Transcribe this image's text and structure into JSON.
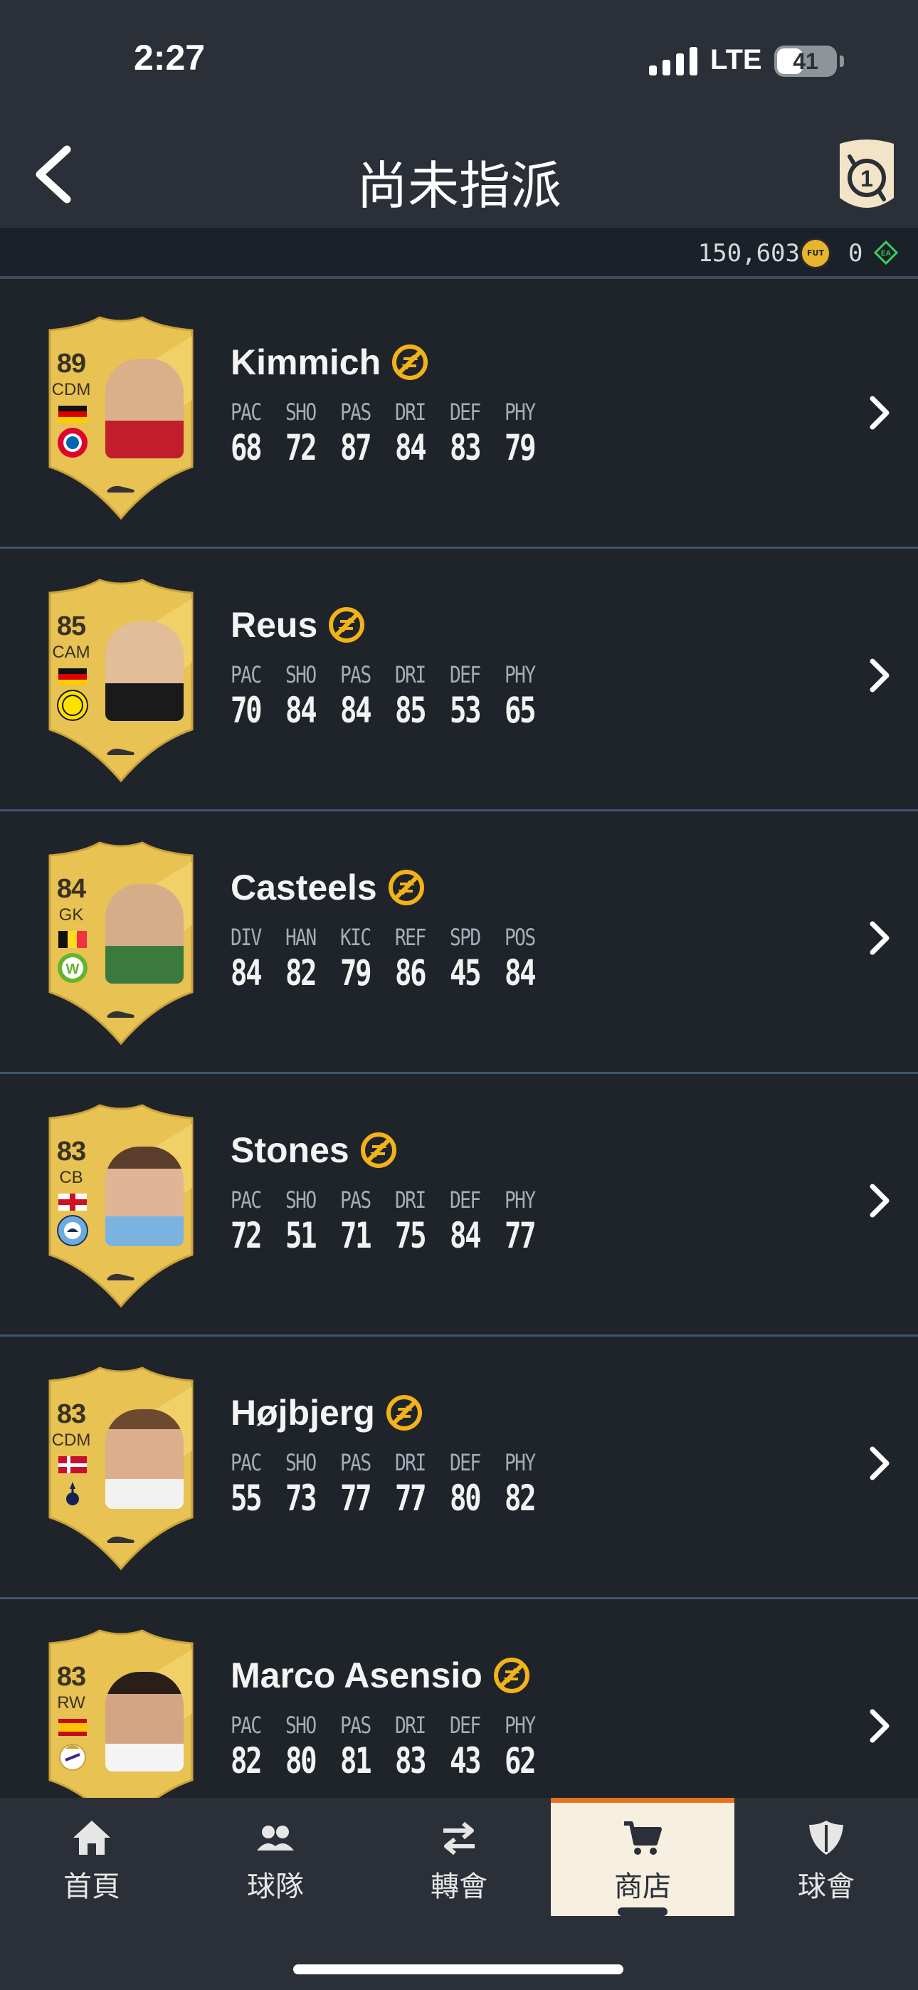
{
  "status_bar": {
    "time": "2:27",
    "network": "LTE",
    "battery": "41",
    "battery_level": 0.41
  },
  "nav": {
    "title": "尚未指派",
    "back_icon": "chevron-left-icon",
    "objective_icon": "objective-badge-icon"
  },
  "currency": {
    "coins": "150,603",
    "points": "0",
    "coin_icon": "fut-coin-icon",
    "points_icon": "ea-points-icon"
  },
  "colors": {
    "background": "#1f232a",
    "bar": "#2b2f37",
    "gold": "#e8c252",
    "accent": "#e8731e",
    "untradeable": "#f2b318"
  },
  "players": [
    {
      "name": "Kimmich",
      "rating": "89",
      "position": "CDM",
      "stats": [
        {
          "label": "PAC",
          "value": "68"
        },
        {
          "label": "SHO",
          "value": "72"
        },
        {
          "label": "PAS",
          "value": "87"
        },
        {
          "label": "DRI",
          "value": "84"
        },
        {
          "label": "DEF",
          "value": "83"
        },
        {
          "label": "PHY",
          "value": "79"
        }
      ]
    },
    {
      "name": "Reus",
      "rating": "85",
      "position": "CAM",
      "stats": [
        {
          "label": "PAC",
          "value": "70"
        },
        {
          "label": "SHO",
          "value": "84"
        },
        {
          "label": "PAS",
          "value": "84"
        },
        {
          "label": "DRI",
          "value": "85"
        },
        {
          "label": "DEF",
          "value": "53"
        },
        {
          "label": "PHY",
          "value": "65"
        }
      ]
    },
    {
      "name": "Casteels",
      "rating": "84",
      "position": "GK",
      "stats": [
        {
          "label": "DIV",
          "value": "84"
        },
        {
          "label": "HAN",
          "value": "82"
        },
        {
          "label": "KIC",
          "value": "79"
        },
        {
          "label": "REF",
          "value": "86"
        },
        {
          "label": "SPD",
          "value": "45"
        },
        {
          "label": "POS",
          "value": "84"
        }
      ]
    },
    {
      "name": "Stones",
      "rating": "83",
      "position": "CB",
      "stats": [
        {
          "label": "PAC",
          "value": "72"
        },
        {
          "label": "SHO",
          "value": "51"
        },
        {
          "label": "PAS",
          "value": "71"
        },
        {
          "label": "DRI",
          "value": "75"
        },
        {
          "label": "DEF",
          "value": "84"
        },
        {
          "label": "PHY",
          "value": "77"
        }
      ]
    },
    {
      "name": "Højbjerg",
      "rating": "83",
      "position": "CDM",
      "stats": [
        {
          "label": "PAC",
          "value": "55"
        },
        {
          "label": "SHO",
          "value": "73"
        },
        {
          "label": "PAS",
          "value": "77"
        },
        {
          "label": "DRI",
          "value": "77"
        },
        {
          "label": "DEF",
          "value": "80"
        },
        {
          "label": "PHY",
          "value": "82"
        }
      ]
    },
    {
      "name": "Marco Asensio",
      "rating": "83",
      "position": "RW",
      "stats": [
        {
          "label": "PAC",
          "value": "82"
        },
        {
          "label": "SHO",
          "value": "80"
        },
        {
          "label": "PAS",
          "value": "81"
        },
        {
          "label": "DRI",
          "value": "83"
        },
        {
          "label": "DEF",
          "value": "43"
        },
        {
          "label": "PHY",
          "value": "62"
        }
      ]
    }
  ],
  "tabs": [
    {
      "label": "首頁",
      "icon": "home-icon"
    },
    {
      "label": "球隊",
      "icon": "squad-icon"
    },
    {
      "label": "轉會",
      "icon": "transfer-arrows-icon"
    },
    {
      "label": "商店",
      "icon": "cart-icon",
      "active": true
    },
    {
      "label": "球會",
      "icon": "club-shield-icon"
    }
  ]
}
